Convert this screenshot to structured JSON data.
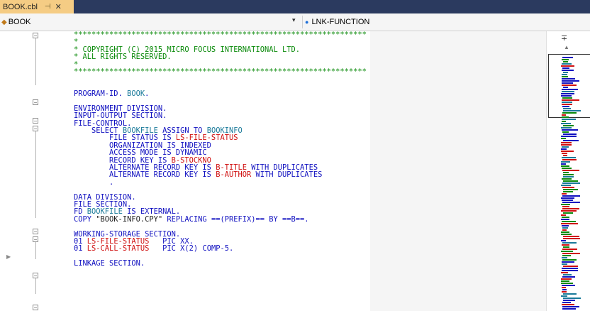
{
  "tab": {
    "filename": "BOOK.cbl",
    "pin_glyph": "⊣",
    "close_glyph": "✕"
  },
  "navbar": {
    "left_label": "BOOK",
    "right_label": "LNK-FUNCTION"
  },
  "code_lines": [
    [
      {
        "t": "******************************************************************",
        "c": "g"
      }
    ],
    [
      {
        "t": "*",
        "c": "g"
      }
    ],
    [
      {
        "t": "* COPYRIGHT (C) 2015 MICRO FOCUS INTERNATIONAL LTD.",
        "c": "g"
      }
    ],
    [
      {
        "t": "* ALL RIGHTS RESERVED.",
        "c": "g"
      }
    ],
    [
      {
        "t": "*",
        "c": "g"
      }
    ],
    [
      {
        "t": "******************************************************************",
        "c": "g"
      }
    ],
    [],
    [],
    [
      {
        "t": "PROGRAM-ID. ",
        "c": "b"
      },
      {
        "t": "BOOK",
        "c": "t"
      },
      {
        "t": ".",
        "c": "b"
      }
    ],
    [],
    [
      {
        "t": "ENVIRONMENT DIVISION.",
        "c": "b"
      }
    ],
    [
      {
        "t": "INPUT-OUTPUT SECTION.",
        "c": "b"
      }
    ],
    [
      {
        "t": "FILE-CONTROL.",
        "c": "b"
      }
    ],
    [
      {
        "t": "    SELECT ",
        "c": "b"
      },
      {
        "t": "BOOKFILE",
        "c": "t"
      },
      {
        "t": " ASSIGN TO ",
        "c": "b"
      },
      {
        "t": "BOOKINFO",
        "c": "t"
      }
    ],
    [
      {
        "t": "        FILE STATUS IS ",
        "c": "b"
      },
      {
        "t": "LS-FILE-STATUS",
        "c": "r"
      }
    ],
    [
      {
        "t": "        ORGANIZATION IS INDEXED",
        "c": "b"
      }
    ],
    [
      {
        "t": "        ACCESS MODE IS DYNAMIC",
        "c": "b"
      }
    ],
    [
      {
        "t": "        RECORD KEY IS ",
        "c": "b"
      },
      {
        "t": "B-STOCKNO",
        "c": "r"
      }
    ],
    [
      {
        "t": "        ALTERNATE RECORD KEY IS ",
        "c": "b"
      },
      {
        "t": "B-TITLE",
        "c": "r"
      },
      {
        "t": " WITH DUPLICATES",
        "c": "b"
      }
    ],
    [
      {
        "t": "        ALTERNATE RECORD KEY IS ",
        "c": "b"
      },
      {
        "t": "B-AUTHOR",
        "c": "r"
      },
      {
        "t": " WITH DUPLICATES",
        "c": "b"
      }
    ],
    [
      {
        "t": "        .",
        "c": "b"
      }
    ],
    [],
    [
      {
        "t": "DATA DIVISION.",
        "c": "b"
      }
    ],
    [
      {
        "t": "FILE SECTION.",
        "c": "b"
      }
    ],
    [
      {
        "t": "FD ",
        "c": "b"
      },
      {
        "t": "BOOKFILE",
        "c": "t"
      },
      {
        "t": " IS EXTERNAL.",
        "c": "b"
      }
    ],
    [
      {
        "t": "COPY ",
        "c": "b"
      },
      {
        "t": "\"BOOK-INFO.CPY\"",
        "c": "k"
      },
      {
        "t": " REPLACING ==(PREFIX)== BY ==B==.",
        "c": "b"
      }
    ],
    [],
    [
      {
        "t": "WORKING-STORAGE SECTION.",
        "c": "b"
      }
    ],
    [
      {
        "t": "01 ",
        "c": "b"
      },
      {
        "t": "LS-FILE-STATUS",
        "c": "r"
      },
      {
        "t": "   PIC XX.",
        "c": "b"
      }
    ],
    [
      {
        "t": "01 ",
        "c": "b"
      },
      {
        "t": "LS-CALL-STATUS",
        "c": "r"
      },
      {
        "t": "   PIC X(2) COMP-5.",
        "c": "b"
      }
    ],
    [],
    [
      {
        "t": "LINKAGE SECTION.",
        "c": "b"
      }
    ]
  ],
  "colors": {
    "green": "#0a8a0a",
    "blue": "#1010c0",
    "red": "#d01010",
    "teal": "#1a7a9a"
  },
  "minimap": {
    "split_glyph": "∓",
    "up_glyph": "▲"
  }
}
